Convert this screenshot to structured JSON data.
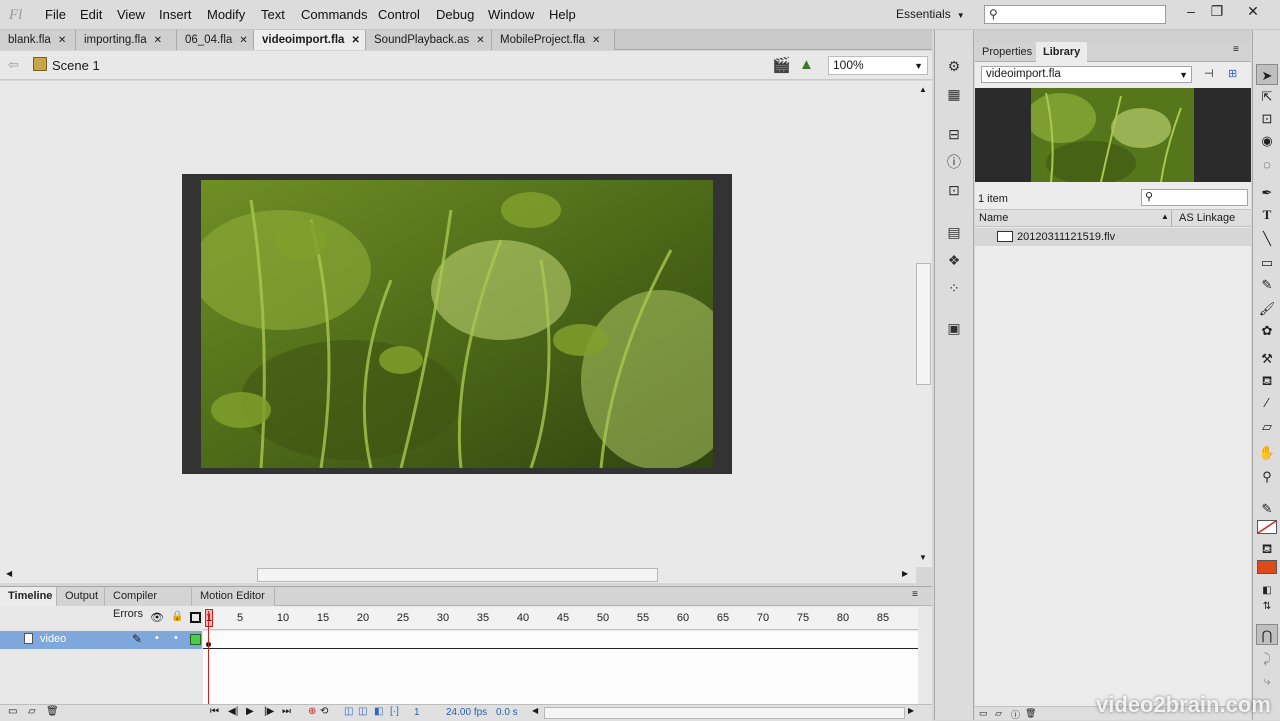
{
  "app": {
    "logo": "Fl",
    "workspace": "Essentials"
  },
  "menu": [
    "File",
    "Edit",
    "View",
    "Insert",
    "Modify",
    "Text",
    "Commands",
    "Control",
    "Debug",
    "Window",
    "Help"
  ],
  "doc_tabs": [
    "blank.fla",
    "importing.fla",
    "06_04.fla",
    "videoimport.fla",
    "SoundPlayback.as",
    "MobileProject.fla"
  ],
  "active_doc_tab": "videoimport.fla",
  "editbar": {
    "scene": "Scene 1",
    "zoom": "100%"
  },
  "panel_tabs": [
    "Timeline",
    "Output",
    "Compiler Errors",
    "Motion Editor"
  ],
  "timeline": {
    "ruler": [
      "1",
      "5",
      "10",
      "15",
      "20",
      "25",
      "30",
      "35",
      "40",
      "45",
      "50",
      "55",
      "60",
      "65",
      "70",
      "75",
      "80",
      "85"
    ],
    "layer_name": "video",
    "current_frame": "1",
    "fps": "24.00",
    "fps_unit": "fps",
    "time": "0.0 s"
  },
  "library": {
    "tabs": [
      "Properties",
      "Library"
    ],
    "active_tab": "Library",
    "document": "videoimport.fla",
    "count": "1 item",
    "columns": [
      "Name",
      "AS Linkage"
    ],
    "items": [
      "20120311121519.flv"
    ]
  },
  "watermark": "video2brain.com"
}
